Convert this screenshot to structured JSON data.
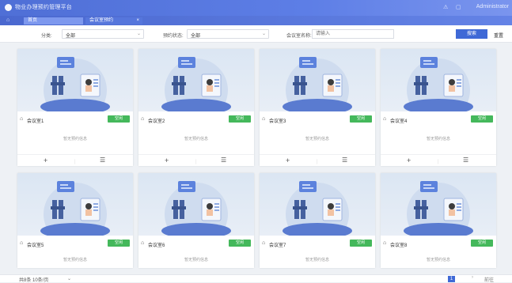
{
  "header": {
    "title": "物业办理预约管理平台",
    "user_name": "Administrator",
    "icons": [
      "bell-icon",
      "fullscreen-icon",
      "avatar-icon"
    ]
  },
  "tabs": [
    {
      "label": "首页",
      "active": true
    },
    {
      "label": "会议室预约",
      "active": false
    }
  ],
  "filters": {
    "category_label": "分类:",
    "category_value": "全部",
    "status_label": "预约状态:",
    "status_value": "全部",
    "name_label": "会议室名称:",
    "name_placeholder": "请输入",
    "search_label": "搜索",
    "reset_label": "重置"
  },
  "cards": [
    {
      "name": "会议室1",
      "status": "空闲",
      "note": "暂无预约信息"
    },
    {
      "name": "会议室2",
      "status": "空闲",
      "note": "暂无预约信息"
    },
    {
      "name": "会议室3",
      "status": "空闲",
      "note": "暂无预约信息"
    },
    {
      "name": "会议室4",
      "status": "空闲",
      "note": "暂无预约信息"
    },
    {
      "name": "会议室5",
      "status": "空闲",
      "note": "暂无预约信息"
    },
    {
      "name": "会议室6",
      "status": "空闲",
      "note": "暂无预约信息"
    },
    {
      "name": "会议室7",
      "status": "空闲",
      "note": "暂无预约信息"
    },
    {
      "name": "会议室8",
      "status": "空闲",
      "note": "暂无预约信息"
    }
  ],
  "pagination": {
    "total": "共8条 10条/页",
    "page_size": "⌄",
    "current_page": "1",
    "next": "›",
    "goto": "前往"
  },
  "colors": {
    "accent": "#3f69d6",
    "header": "#5d7ee6",
    "status_free": "#44b85b"
  }
}
